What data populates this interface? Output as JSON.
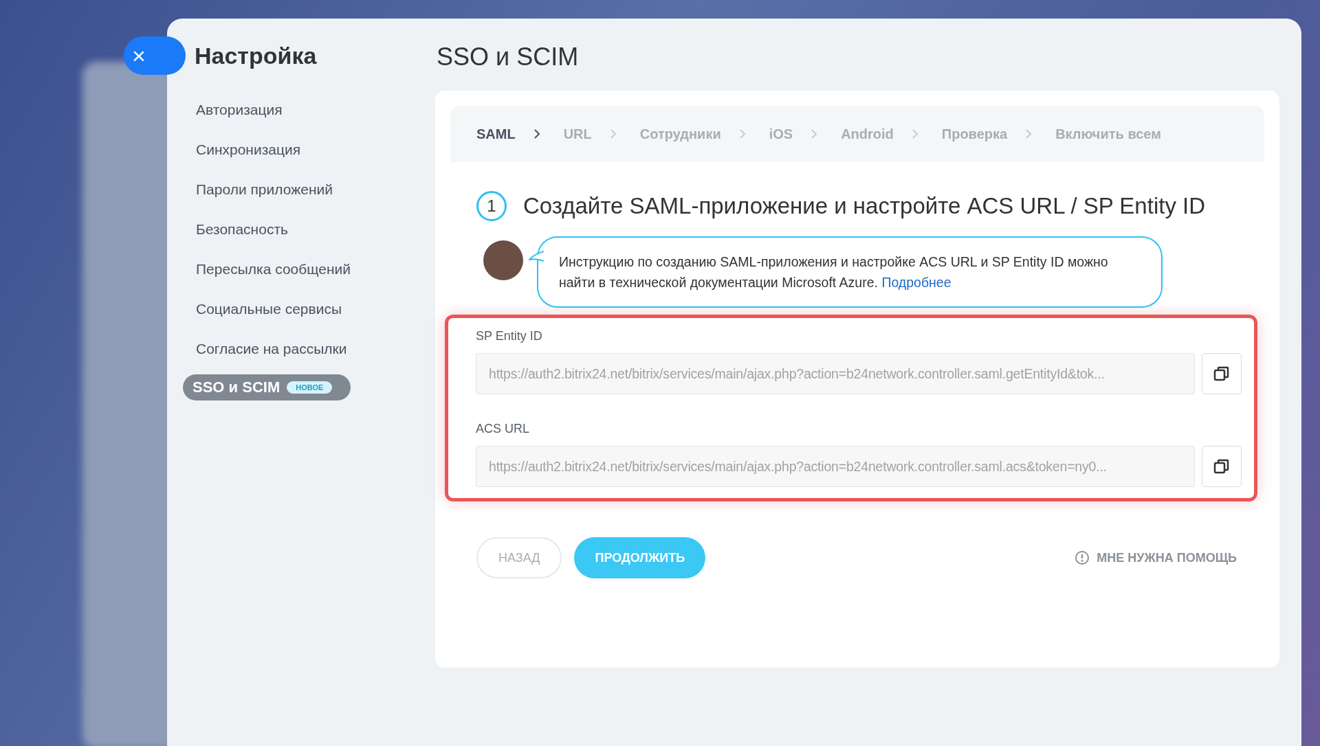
{
  "close_button": {
    "label": "×"
  },
  "sidebar": {
    "title": "Настройка",
    "items": [
      {
        "label": "Авторизация",
        "selected": false
      },
      {
        "label": "Синхронизация",
        "selected": false
      },
      {
        "label": "Пароли приложений",
        "selected": false
      },
      {
        "label": "Безопасность",
        "selected": false
      },
      {
        "label": "Пересылка сообщений",
        "selected": false
      },
      {
        "label": "Социальные сервисы",
        "selected": false
      },
      {
        "label": "Согласие на рассылки",
        "selected": false
      },
      {
        "label": "SSO и SCIM",
        "selected": true,
        "badge": "НОВОЕ"
      }
    ]
  },
  "page_title": "SSO и SCIM",
  "steps": [
    {
      "label": "SAML",
      "selected": true
    },
    {
      "label": "URL",
      "selected": false
    },
    {
      "label": "Сотрудники",
      "selected": false
    },
    {
      "label": "iOS",
      "selected": false
    },
    {
      "label": "Android",
      "selected": false
    },
    {
      "label": "Проверка",
      "selected": false
    },
    {
      "label": "Включить всем",
      "selected": false
    }
  ],
  "step_number": "1",
  "step_heading": "Создайте SAML-приложение и настройте ACS URL / SP Entity ID",
  "hint": {
    "text": "Инструкцию по созданию SAML-приложения и настройке ACS URL и SP Entity ID можно найти в технической документации Microsoft Azure.",
    "link": "Подробнее"
  },
  "fields": [
    {
      "label": "SP Entity ID",
      "value": "https://auth2.bitrix24.net/bitrix/services/main/ajax.php?action=b24network.controller.saml.getEntityId&tok..."
    },
    {
      "label": "ACS URL",
      "value": "https://auth2.bitrix24.net/bitrix/services/main/ajax.php?action=b24network.controller.saml.acs&token=ny0..."
    }
  ],
  "buttons": {
    "back": "НАЗАД",
    "continue": "ПРОДОЛЖИТЬ",
    "help": "МНЕ НУЖНА ПОМОЩЬ"
  }
}
